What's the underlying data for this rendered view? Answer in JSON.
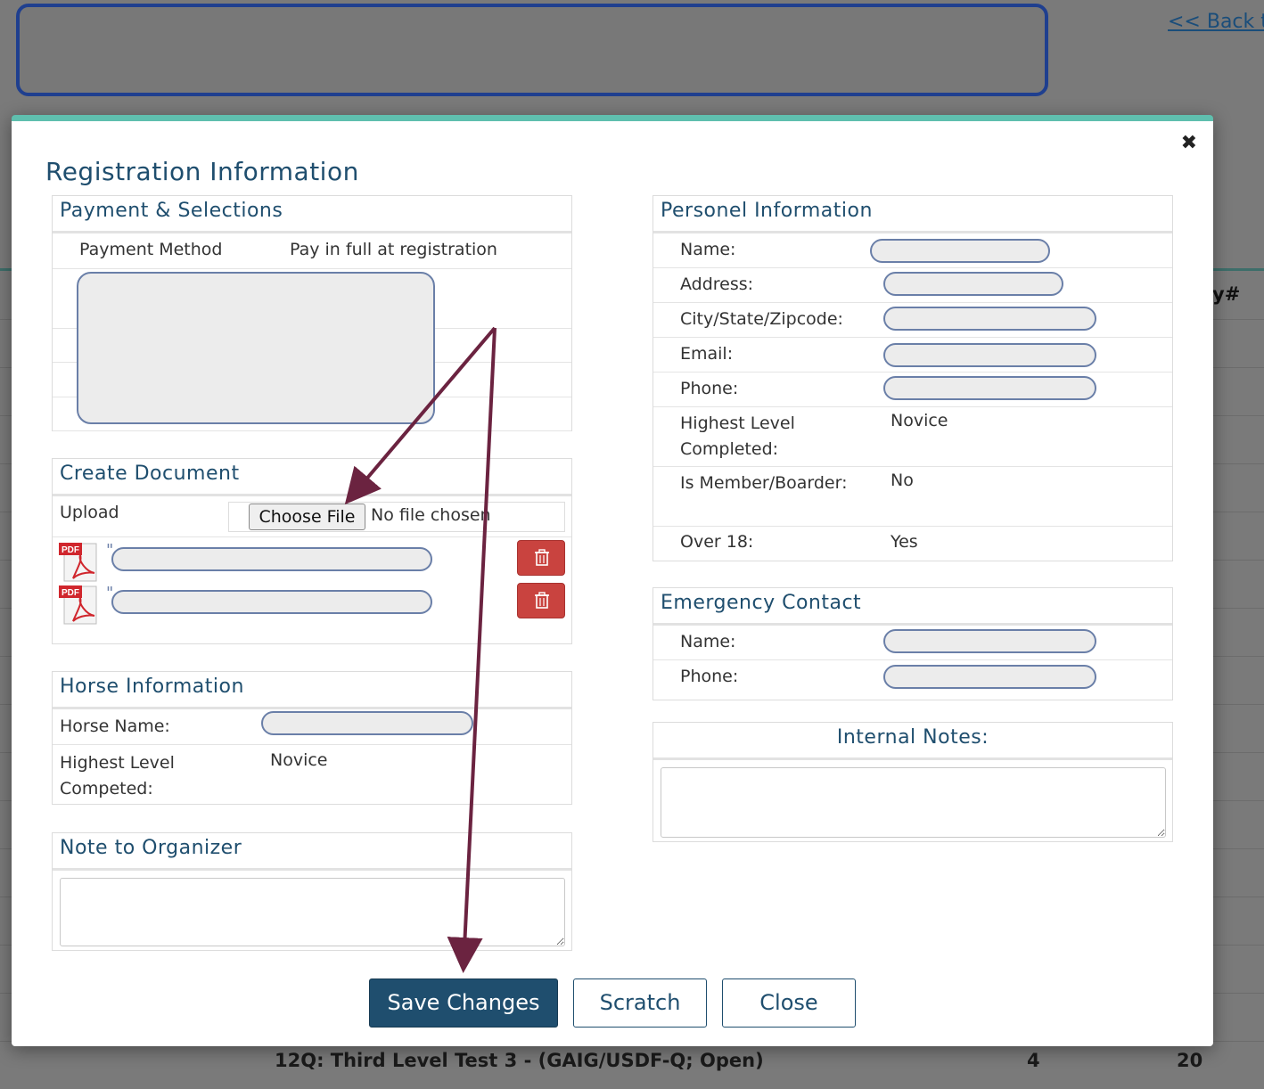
{
  "background": {
    "back_link": "<< Back to",
    "column_head": "y#",
    "bottom_row": {
      "name": "12Q: Third Level Test 3 - (GAIG/USDF-Q; Open)",
      "col1": "4",
      "col2": "20"
    }
  },
  "modal": {
    "title": "Registration Information",
    "close": "✖",
    "payment": {
      "heading": "Payment & Selections",
      "method_label": "Payment Method",
      "method_value": "Pay in full at registration"
    },
    "document": {
      "heading": "Create Document",
      "upload_label": "Upload",
      "choose_file": "Choose File",
      "no_file": "No file chosen",
      "files": [
        {
          "icon": "pdf-icon",
          "prefix": "\""
        },
        {
          "icon": "pdf-icon",
          "prefix": "\""
        }
      ]
    },
    "horse": {
      "heading": "Horse Information",
      "name_label": "Horse Name:",
      "level_label": "Highest Level Competed:",
      "level_value": "Novice"
    },
    "note": {
      "heading": "Note to Organizer",
      "value": ""
    },
    "personal": {
      "heading": "Personel Information",
      "name_label": "Name:",
      "address_label": "Address:",
      "city_label": "City/State/Zipcode:",
      "email_label": "Email:",
      "phone_label": "Phone:",
      "level_label": "Highest Level Completed:",
      "level_value": "Novice",
      "member_label": "Is Member/Boarder:",
      "member_value": "No",
      "over18_label": "Over 18:",
      "over18_value": "Yes"
    },
    "emergency": {
      "heading": "Emergency Contact",
      "name_label": "Name:",
      "phone_label": "Phone:"
    },
    "internal": {
      "heading": "Internal Notes:",
      "value": ""
    },
    "buttons": {
      "save": "Save Changes",
      "scratch": "Scratch",
      "close": "Close"
    },
    "colors": {
      "accent": "#1f4e6e",
      "teal": "#5fbfae",
      "danger": "#c9433f",
      "annotation": "#6b2340"
    }
  }
}
